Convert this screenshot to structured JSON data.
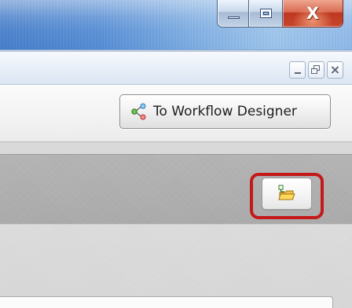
{
  "window": {
    "controls": {
      "close_label": "X"
    }
  },
  "view": {
    "close_label": "×"
  },
  "toolbar": {
    "workflow_button_label": "To Workflow Designer",
    "workflow_icon": "workflow-designer-icon"
  },
  "section": {
    "open_icon": "open-folder-icon",
    "highlight_color": "#c51818"
  }
}
